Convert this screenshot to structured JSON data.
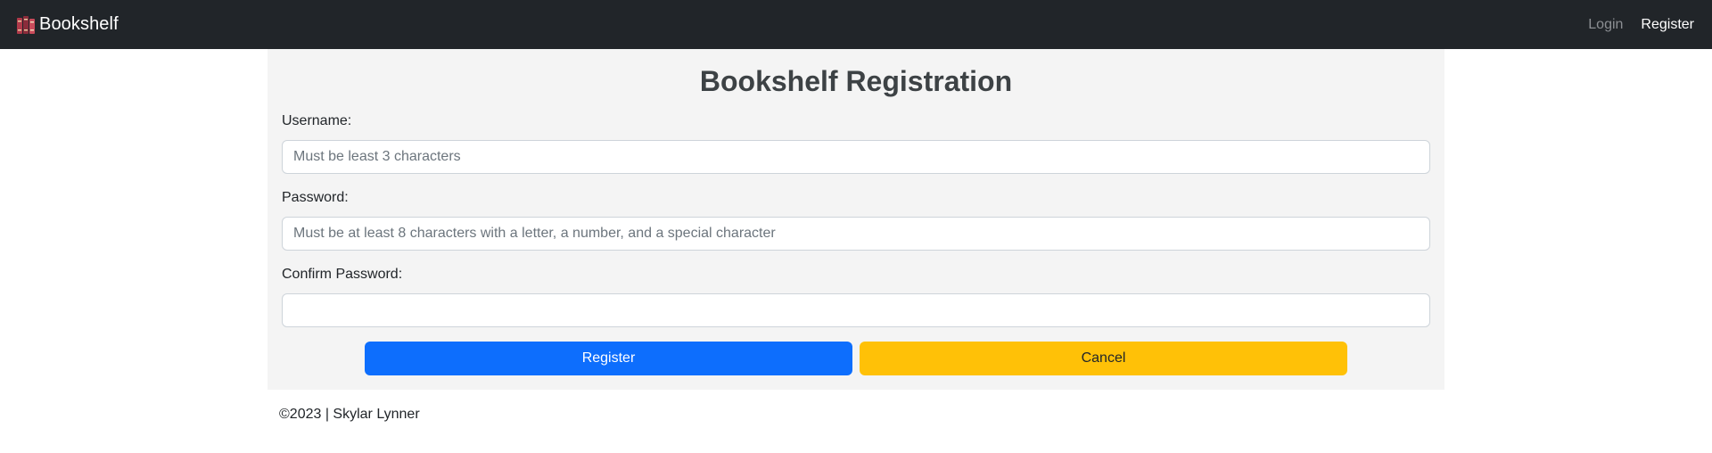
{
  "navbar": {
    "brand": "Bookshelf",
    "brand_icon": "books-icon",
    "links": [
      {
        "label": "Login"
      },
      {
        "label": "Register"
      }
    ]
  },
  "form": {
    "title": "Bookshelf Registration",
    "username": {
      "label": "Username:",
      "placeholder": "Must be least 3 characters",
      "value": ""
    },
    "password": {
      "label": "Password:",
      "placeholder": "Must be at least 8 characters with a letter, a number, and a special character",
      "value": ""
    },
    "confirm_password": {
      "label": "Confirm Password:",
      "placeholder": "",
      "value": ""
    },
    "register_label": "Register",
    "cancel_label": "Cancel"
  },
  "footer": {
    "text": "©2023 | Skylar Lynner"
  },
  "colors": {
    "navbar_bg": "#212529",
    "panel_bg": "#f4f4f4",
    "primary": "#0d6efd",
    "warning": "#ffc107"
  }
}
